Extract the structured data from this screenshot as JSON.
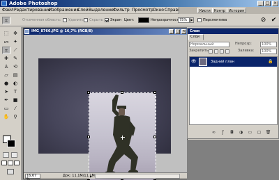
{
  "app": {
    "title": "Adobe Photoshop",
    "window_buttons": {
      "minimize": "_",
      "maximize": "□",
      "close": "×"
    }
  },
  "menu": {
    "items": [
      "Файл",
      "Редактирование",
      "Изображение",
      "Слой",
      "Выделение",
      "Фильтр",
      "Просмотр",
      "Окно",
      "Справка"
    ]
  },
  "palette_well": {
    "tabs": [
      "Кисти",
      "Контр",
      "История"
    ]
  },
  "options_bar": {
    "selected_area_label": "Отсеченная область:",
    "delete_label": "Удалить",
    "hide_label": "Скрыть",
    "shield_label": "Экран",
    "shield_checked": true,
    "color_label": "Цвет:",
    "color_value": "#000000",
    "opacity_label": "Непрозрачность:",
    "opacity_value": "75%",
    "perspective_label": "Перспектива",
    "perspective_checked": false,
    "cancel_icon": "⊘",
    "commit_icon": "✔"
  },
  "document": {
    "title": "IMG_8766.JPG @ 16,7% (RGB/8)",
    "zoom": "16,67 %",
    "doc_info": "Док: 11,1M/11,1M",
    "arrow": "▶"
  },
  "layers_panel": {
    "title": "Слои",
    "tab": "Слои",
    "blend_mode": "Нормальный",
    "opacity_label": "Непрозр:",
    "opacity_value": "100%",
    "lock_label": "Закрепить:",
    "fill_label": "Заливка:",
    "fill_value": "100%",
    "layer_name": "Задний план",
    "eye_icon": "👁",
    "lock_icon": "🔒"
  },
  "colors": {
    "title_bar": "#0a246a",
    "chrome": "#d4d0c8",
    "workspace": "#808080",
    "selection_highlight": "#0a246a"
  }
}
